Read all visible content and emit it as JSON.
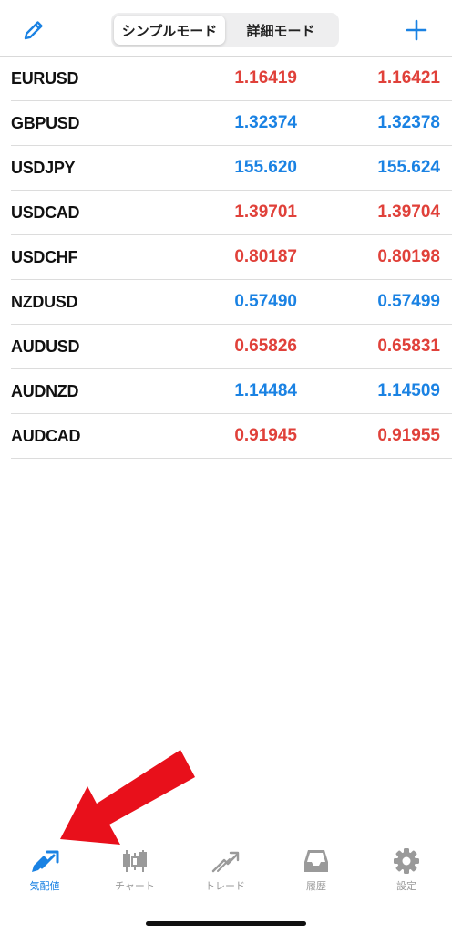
{
  "header": {
    "edit_icon": "pencil-icon",
    "segments": [
      {
        "label": "シンプルモード",
        "active": true
      },
      {
        "label": "詳細モード",
        "active": false
      }
    ],
    "add_icon": "plus-icon",
    "accent": "#1a82e3"
  },
  "quotes": [
    {
      "symbol": "EURUSD",
      "bid": "1.16419",
      "ask": "1.16421",
      "dir": "down"
    },
    {
      "symbol": "GBPUSD",
      "bid": "1.32374",
      "ask": "1.32378",
      "dir": "up"
    },
    {
      "symbol": "USDJPY",
      "bid": "155.620",
      "ask": "155.624",
      "dir": "up"
    },
    {
      "symbol": "USDCAD",
      "bid": "1.39701",
      "ask": "1.39704",
      "dir": "down"
    },
    {
      "symbol": "USDCHF",
      "bid": "0.80187",
      "ask": "0.80198",
      "dir": "down"
    },
    {
      "symbol": "NZDUSD",
      "bid": "0.57490",
      "ask": "0.57499",
      "dir": "up"
    },
    {
      "symbol": "AUDUSD",
      "bid": "0.65826",
      "ask": "0.65831",
      "dir": "down"
    },
    {
      "symbol": "AUDNZD",
      "bid": "1.14484",
      "ask": "1.14509",
      "dir": "up"
    },
    {
      "symbol": "AUDCAD",
      "bid": "0.91945",
      "ask": "0.91955",
      "dir": "down"
    }
  ],
  "colors": {
    "up": "#1a82e3",
    "down": "#e0413a",
    "annotation_arrow": "#e8101b"
  },
  "tabs": [
    {
      "label": "気配値",
      "icon": "quotes-icon",
      "active": true
    },
    {
      "label": "チャート",
      "icon": "candlestick-chart-icon",
      "active": false
    },
    {
      "label": "トレード",
      "icon": "trade-icon",
      "active": false
    },
    {
      "label": "履歴",
      "icon": "history-inbox-icon",
      "active": false
    },
    {
      "label": "設定",
      "icon": "gear-icon",
      "active": false
    }
  ]
}
